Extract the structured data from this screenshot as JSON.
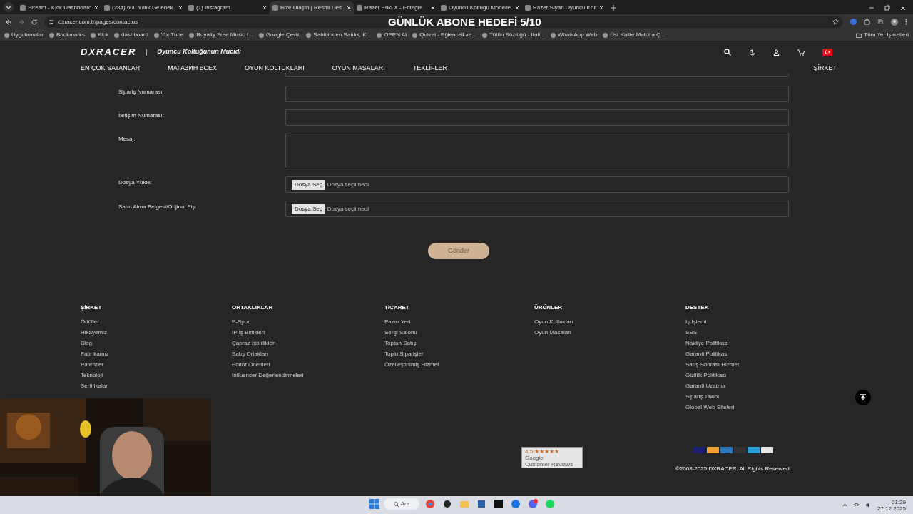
{
  "browser": {
    "tabs": [
      {
        "title": "Stream - Kick Dashboard",
        "selected": false
      },
      {
        "title": "(284) 600 Yıllık Gelenek",
        "selected": false
      },
      {
        "title": "(1) Instagram",
        "selected": false
      },
      {
        "title": "Bize Ulaşın | Resmi Des",
        "selected": true
      },
      {
        "title": "Razer Enki X - Entegre",
        "selected": false
      },
      {
        "title": "Oyuncu Koltuğu Modelle",
        "selected": false
      },
      {
        "title": "Razer Siyah Oyuncu Kolt",
        "selected": false
      }
    ],
    "url": "dxracer.com.tr/pages/contactus",
    "bookmarks": [
      "Uygulamalar",
      "Bookmarks",
      "Kick",
      "dashboard",
      "YouTube",
      "Royalty Free Music f...",
      "Google Çeviri",
      "Sahibinden Satılık, K...",
      "OPEN AI",
      "Quizei - Eğlenceli ve...",
      "Tütün Sözlüğü - İtali...",
      "WhatsApp Web",
      "Üst Kalite Matcha Ç..."
    ],
    "all_bookmarks": "Tüm Yer İşaretleri"
  },
  "overlay_text": "GÜNLÜK ABONE HEDEFİ 5/10",
  "header": {
    "logo": "DXRACER",
    "tagline": "Oyuncu Koltuğunun Mucidi",
    "nav": [
      "EN ÇOK SATANLAR",
      "МАГАЗИН ВСЕХ",
      "OYUN KOLTUKLARI",
      "OYUN MASALARI",
      "TEKLİFLER"
    ],
    "nav_right": "ŞİRKET"
  },
  "form": {
    "fields": [
      {
        "label": "Sipariş Numarası:",
        "kind": "text"
      },
      {
        "label": "İletişim Numarası:",
        "kind": "text"
      },
      {
        "label": "Mesaj:",
        "kind": "textarea"
      },
      {
        "label": "Dosya Yükle:",
        "kind": "file",
        "button": "Dosya Seç",
        "status": "Dosya seçilmedi"
      },
      {
        "label": "Satın Alma Belgesi/Orijinal Fiş:",
        "kind": "file",
        "button": "Dosya Seç",
        "status": "Dosya seçilmedi"
      }
    ],
    "submit": "Gönder"
  },
  "footer": {
    "columns": [
      {
        "heading": "ŞİRKET",
        "links": [
          "Ödüller",
          "Hikayemiz",
          "Blog",
          "Fabrikamız",
          "Patentler",
          "Teknoloji",
          "Sertifikalar"
        ]
      },
      {
        "heading": "ORTAKLIKLAR",
        "links": [
          "E-Spor",
          "IP İş Birlikleri",
          "Çapraz İşbirlikleri",
          "Satış Ortakları",
          "Editör Önerileri",
          "Influencer Değerlendirmeleri"
        ]
      },
      {
        "heading": "TİCARET",
        "links": [
          "Pazar Yeri",
          "Sergi Salonu",
          "Toptan Satış",
          "Toplu Siparişler",
          "Özelleştirilmiş Hizmet"
        ]
      },
      {
        "heading": "ÜRÜNLER",
        "links": [
          "Oyun Koltukları",
          "Oyun Masaları"
        ]
      },
      {
        "heading": "DESTEK",
        "links": [
          "İş İşlemi",
          "SSS",
          "Nakliye Politikası",
          "Garanti Politikası",
          "Satış Sonrası Hizmet",
          "Gizlilik Politikası",
          "Garanti Uzatma",
          "Sipariş Takibi",
          "Global Web Siteleri"
        ]
      }
    ],
    "reviews": {
      "rating": "4.5 ★★★★★",
      "source": "Google",
      "caption": "Customer Reviews"
    },
    "payments": [
      {
        "color": "#1a1f71"
      },
      {
        "color": "#f0a030"
      },
      {
        "color": "#2e77bb"
      },
      {
        "color": "#333333"
      },
      {
        "color": "#2a9fd6"
      },
      {
        "color": "#e6e6e6"
      }
    ],
    "copyright": "©2003-2025 DXRACER. All Rights Reserved."
  },
  "taskbar": {
    "search": "Ara",
    "time": "01:29",
    "date": "27.12.2025"
  }
}
